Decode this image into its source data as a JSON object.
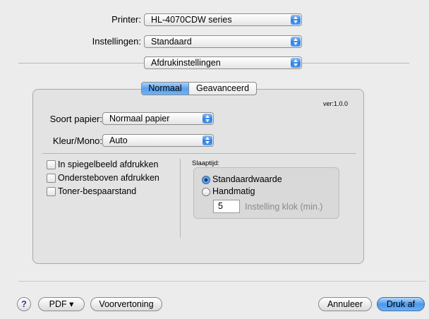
{
  "printer": {
    "label": "Printer:",
    "value": "HL-4070CDW series"
  },
  "presets": {
    "label": "Instellingen:",
    "value": "Standaard"
  },
  "pane": {
    "value": "Afdrukinstellingen"
  },
  "tabs": [
    {
      "label": "Normaal",
      "selected": true
    },
    {
      "label": "Geavanceerd",
      "selected": false
    }
  ],
  "version": "ver:1.0.0",
  "paper_type": {
    "label": "Soort papier:",
    "value": "Normaal papier"
  },
  "color_mode": {
    "label": "Kleur/Mono:",
    "value": "Auto"
  },
  "checkboxes": [
    {
      "label": "In spiegelbeeld afdrukken",
      "checked": false
    },
    {
      "label": "Ondersteboven afdrukken",
      "checked": false
    },
    {
      "label": "Toner-bespaarstand",
      "checked": false
    }
  ],
  "sleep": {
    "title": "Slaaptijd:",
    "options": [
      {
        "label": "Standaardwaarde",
        "selected": true
      },
      {
        "label": "Handmatig",
        "selected": false
      }
    ],
    "field_value": "5",
    "field_hint": "Instelling klok (min.)"
  },
  "footer": {
    "help": "?",
    "pdf": "PDF ▾",
    "preview": "Voorvertoning",
    "cancel": "Annuleer",
    "print": "Druk af"
  },
  "colors": {
    "accent": "#4b98ec",
    "background": "#ececec"
  }
}
